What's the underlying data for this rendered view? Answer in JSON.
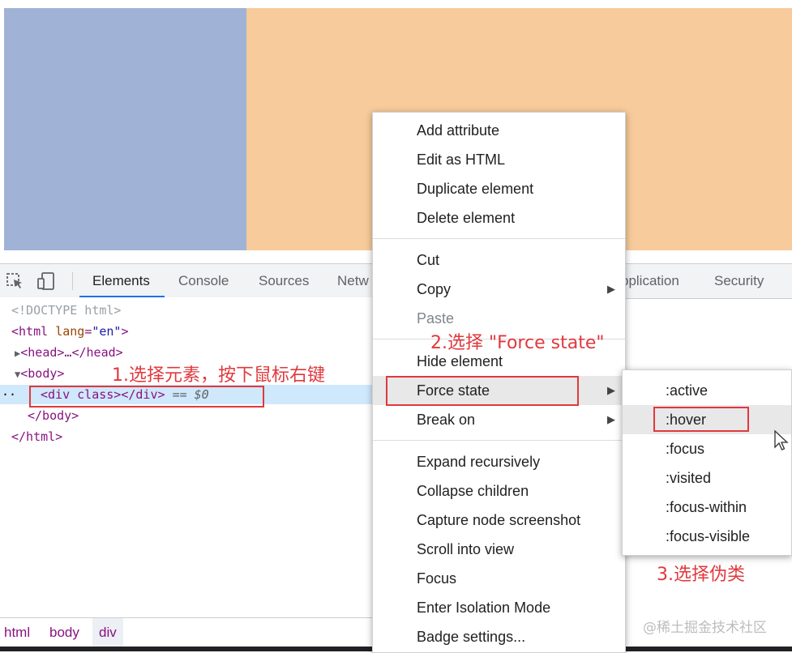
{
  "toolbar": {
    "tabs": [
      "Elements",
      "Console",
      "Sources",
      "Netw",
      "pplication",
      "Security"
    ]
  },
  "dom": {
    "doctype": "<!DOCTYPE html>",
    "html_open_tag": "<html",
    "html_lang_attr": "lang",
    "html_lang_val": "\"en\"",
    "html_open_close": ">",
    "head_line": "<head>…</head>",
    "body_open": "<body>",
    "div_line": "<div class></div>",
    "div_eq": "== $0",
    "body_close": "</body>",
    "html_close": "</html>",
    "row_marker": "··"
  },
  "breadcrumb": [
    "html",
    "body",
    "div"
  ],
  "context_menu": {
    "items": [
      "Add attribute",
      "Edit as HTML",
      "Duplicate element",
      "Delete element",
      "Cut",
      "Copy",
      "Paste",
      "Hide element",
      "Force state",
      "Break on",
      "Expand recursively",
      "Collapse children",
      "Capture node screenshot",
      "Scroll into view",
      "Focus",
      "Enter Isolation Mode",
      "Badge settings..."
    ],
    "submenu_arrow": "▶"
  },
  "force_state_submenu": [
    ":active",
    ":hover",
    ":focus",
    ":visited",
    ":focus-within",
    ":focus-visible"
  ],
  "annotations": {
    "step1": "1.选择元素，按下鼠标右键",
    "step2": "2.选择 \"Force state\"",
    "step3": "3.选择伪类"
  },
  "watermark": "@稀土掘金技术社区",
  "colors": {
    "preview_left": "#a0b2d6",
    "preview_right": "#f7cb9b",
    "annotation_red": "#e0393e",
    "selected_row": "#cfe8fc",
    "active_tab_underline": "#1a73e8"
  }
}
